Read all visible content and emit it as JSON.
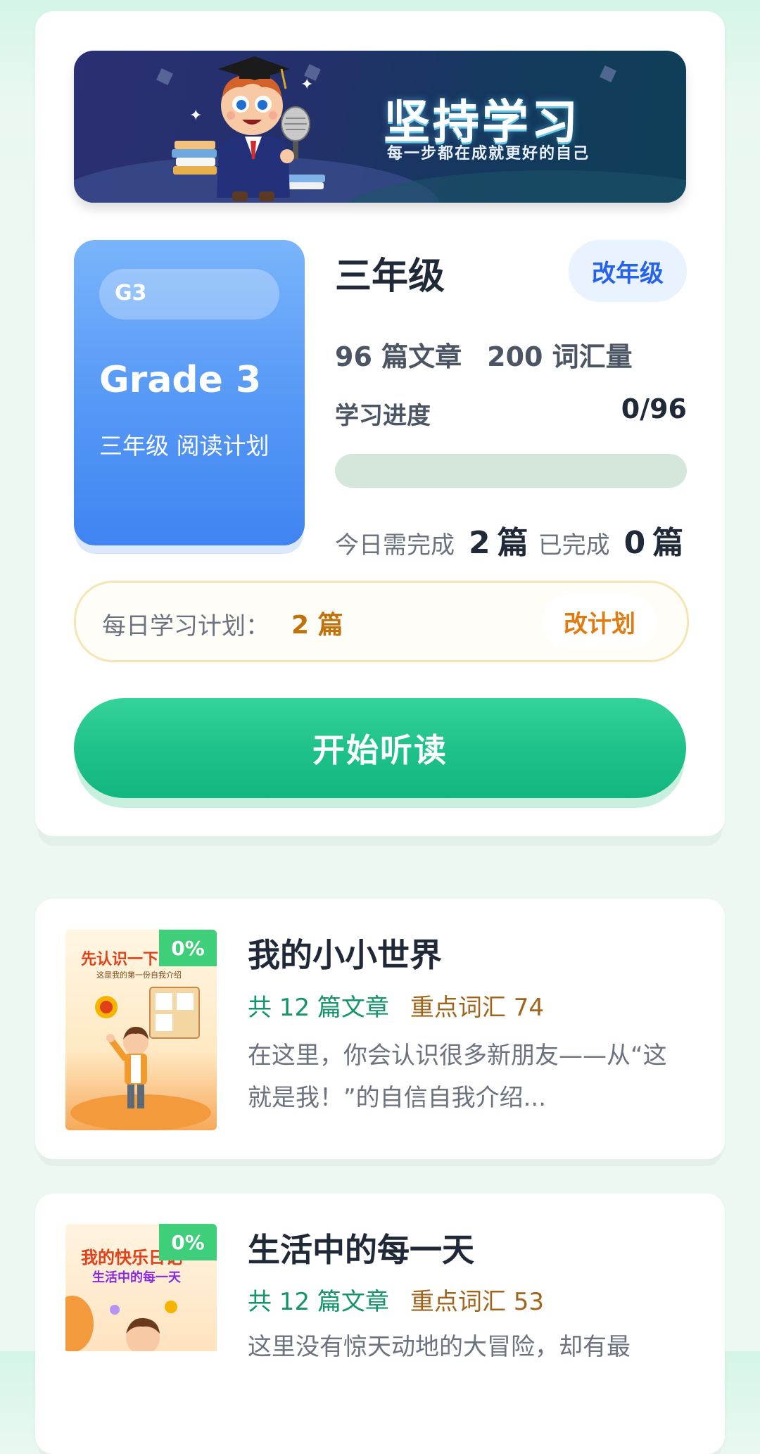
{
  "banner": {
    "title": "坚持学习",
    "subtitle": "每一步都在成就更好的自己"
  },
  "grade_tile": {
    "code": "G3",
    "name_en": "Grade 3",
    "plan_text": "三年级 阅读计划"
  },
  "grade_info": {
    "name": "三年级",
    "change_grade_label": "改年级",
    "articles_text": "96 篇文章",
    "vocab_text": "200 词汇量",
    "progress_label": "学习进度",
    "progress_count": "0/96",
    "progress_value": 0,
    "today_required_label": "今日需完成",
    "today_required_num": "2",
    "today_required_unit": "篇",
    "today_done_label": "已完成",
    "today_done_num": "0",
    "today_done_unit": "篇"
  },
  "daily_plan": {
    "label": "每日学习计划：",
    "value": "2 篇",
    "change_label": "改计划"
  },
  "start_button_label": "开始听读",
  "units": [
    {
      "badge": "0%",
      "cover_title": "先认识一下",
      "cover_subtitle": "这是我的第一份自我介绍",
      "title": "我的小小世界",
      "articles": "共 12 篇文章",
      "vocab": "重点词汇 74",
      "description": "在这里，你会认识很多新朋友——从“这就是我！”的自信自我介绍..."
    },
    {
      "badge": "0%",
      "cover_title": "我的快乐日记",
      "cover_subtitle": "生活中的每一天",
      "title": "生活中的每一天",
      "articles": "共 12 篇文章",
      "vocab": "重点词汇 53",
      "description": "这里没有惊天动地的大冒险，却有最"
    }
  ],
  "colors": {
    "accent_green": "#22c38a",
    "grade_blue": "#3f84f1",
    "plan_orange": "#c0730d"
  }
}
